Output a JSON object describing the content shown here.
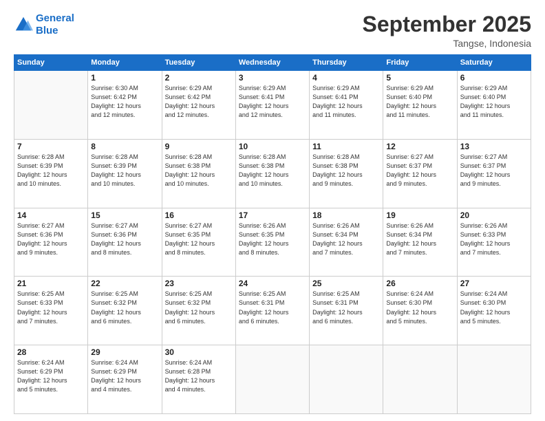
{
  "logo": {
    "line1": "General",
    "line2": "Blue"
  },
  "title": "September 2025",
  "subtitle": "Tangse, Indonesia",
  "days_header": [
    "Sunday",
    "Monday",
    "Tuesday",
    "Wednesday",
    "Thursday",
    "Friday",
    "Saturday"
  ],
  "weeks": [
    [
      {
        "day": "",
        "info": ""
      },
      {
        "day": "1",
        "info": "Sunrise: 6:30 AM\nSunset: 6:42 PM\nDaylight: 12 hours\nand 12 minutes."
      },
      {
        "day": "2",
        "info": "Sunrise: 6:29 AM\nSunset: 6:42 PM\nDaylight: 12 hours\nand 12 minutes."
      },
      {
        "day": "3",
        "info": "Sunrise: 6:29 AM\nSunset: 6:41 PM\nDaylight: 12 hours\nand 12 minutes."
      },
      {
        "day": "4",
        "info": "Sunrise: 6:29 AM\nSunset: 6:41 PM\nDaylight: 12 hours\nand 11 minutes."
      },
      {
        "day": "5",
        "info": "Sunrise: 6:29 AM\nSunset: 6:40 PM\nDaylight: 12 hours\nand 11 minutes."
      },
      {
        "day": "6",
        "info": "Sunrise: 6:29 AM\nSunset: 6:40 PM\nDaylight: 12 hours\nand 11 minutes."
      }
    ],
    [
      {
        "day": "7",
        "info": "Sunrise: 6:28 AM\nSunset: 6:39 PM\nDaylight: 12 hours\nand 10 minutes."
      },
      {
        "day": "8",
        "info": "Sunrise: 6:28 AM\nSunset: 6:39 PM\nDaylight: 12 hours\nand 10 minutes."
      },
      {
        "day": "9",
        "info": "Sunrise: 6:28 AM\nSunset: 6:38 PM\nDaylight: 12 hours\nand 10 minutes."
      },
      {
        "day": "10",
        "info": "Sunrise: 6:28 AM\nSunset: 6:38 PM\nDaylight: 12 hours\nand 10 minutes."
      },
      {
        "day": "11",
        "info": "Sunrise: 6:28 AM\nSunset: 6:38 PM\nDaylight: 12 hours\nand 9 minutes."
      },
      {
        "day": "12",
        "info": "Sunrise: 6:27 AM\nSunset: 6:37 PM\nDaylight: 12 hours\nand 9 minutes."
      },
      {
        "day": "13",
        "info": "Sunrise: 6:27 AM\nSunset: 6:37 PM\nDaylight: 12 hours\nand 9 minutes."
      }
    ],
    [
      {
        "day": "14",
        "info": "Sunrise: 6:27 AM\nSunset: 6:36 PM\nDaylight: 12 hours\nand 9 minutes."
      },
      {
        "day": "15",
        "info": "Sunrise: 6:27 AM\nSunset: 6:36 PM\nDaylight: 12 hours\nand 8 minutes."
      },
      {
        "day": "16",
        "info": "Sunrise: 6:27 AM\nSunset: 6:35 PM\nDaylight: 12 hours\nand 8 minutes."
      },
      {
        "day": "17",
        "info": "Sunrise: 6:26 AM\nSunset: 6:35 PM\nDaylight: 12 hours\nand 8 minutes."
      },
      {
        "day": "18",
        "info": "Sunrise: 6:26 AM\nSunset: 6:34 PM\nDaylight: 12 hours\nand 7 minutes."
      },
      {
        "day": "19",
        "info": "Sunrise: 6:26 AM\nSunset: 6:34 PM\nDaylight: 12 hours\nand 7 minutes."
      },
      {
        "day": "20",
        "info": "Sunrise: 6:26 AM\nSunset: 6:33 PM\nDaylight: 12 hours\nand 7 minutes."
      }
    ],
    [
      {
        "day": "21",
        "info": "Sunrise: 6:25 AM\nSunset: 6:33 PM\nDaylight: 12 hours\nand 7 minutes."
      },
      {
        "day": "22",
        "info": "Sunrise: 6:25 AM\nSunset: 6:32 PM\nDaylight: 12 hours\nand 6 minutes."
      },
      {
        "day": "23",
        "info": "Sunrise: 6:25 AM\nSunset: 6:32 PM\nDaylight: 12 hours\nand 6 minutes."
      },
      {
        "day": "24",
        "info": "Sunrise: 6:25 AM\nSunset: 6:31 PM\nDaylight: 12 hours\nand 6 minutes."
      },
      {
        "day": "25",
        "info": "Sunrise: 6:25 AM\nSunset: 6:31 PM\nDaylight: 12 hours\nand 6 minutes."
      },
      {
        "day": "26",
        "info": "Sunrise: 6:24 AM\nSunset: 6:30 PM\nDaylight: 12 hours\nand 5 minutes."
      },
      {
        "day": "27",
        "info": "Sunrise: 6:24 AM\nSunset: 6:30 PM\nDaylight: 12 hours\nand 5 minutes."
      }
    ],
    [
      {
        "day": "28",
        "info": "Sunrise: 6:24 AM\nSunset: 6:29 PM\nDaylight: 12 hours\nand 5 minutes."
      },
      {
        "day": "29",
        "info": "Sunrise: 6:24 AM\nSunset: 6:29 PM\nDaylight: 12 hours\nand 4 minutes."
      },
      {
        "day": "30",
        "info": "Sunrise: 6:24 AM\nSunset: 6:28 PM\nDaylight: 12 hours\nand 4 minutes."
      },
      {
        "day": "",
        "info": ""
      },
      {
        "day": "",
        "info": ""
      },
      {
        "day": "",
        "info": ""
      },
      {
        "day": "",
        "info": ""
      }
    ]
  ]
}
